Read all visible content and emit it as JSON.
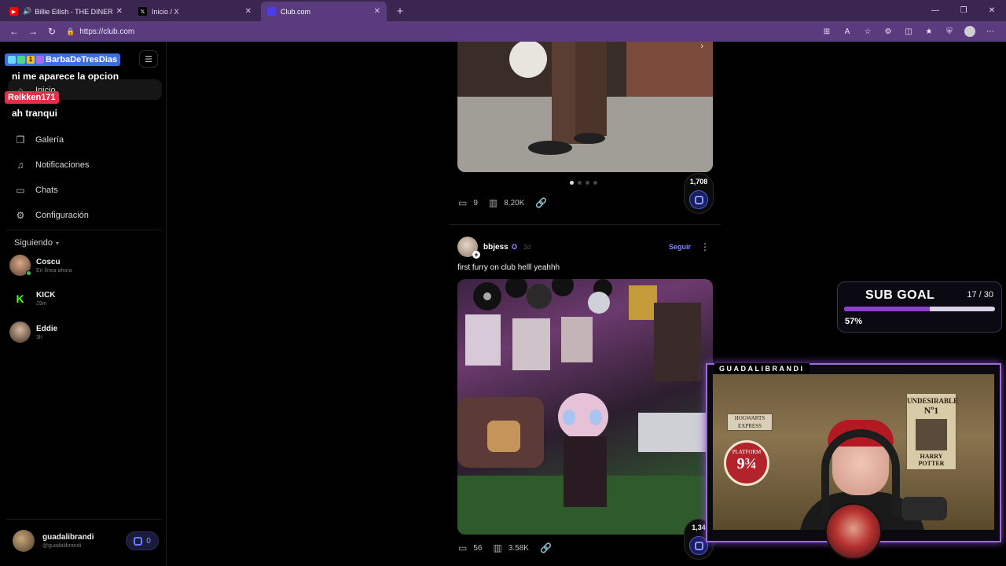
{
  "browser": {
    "tabs": [
      {
        "title": "Billie Eilish - THE DINER (Offic",
        "favicon_color": "#ff0000",
        "audio": true
      },
      {
        "title": "Inicio / X",
        "favicon_color": "#000000"
      },
      {
        "title": "Club.com",
        "favicon_color": "#4b3cf0",
        "active": true
      }
    ],
    "tab_close": "✕",
    "new_tab": "+",
    "url": "https://club.com",
    "accent": "#5a3b7e"
  },
  "chat": {
    "user1": "BarbaDeTresDias",
    "badge_count": "1",
    "msg1": "ni me aparece la opcion",
    "user2": "Reikken171",
    "msg2": "ah tranqui"
  },
  "sidebar": {
    "nav": [
      {
        "label": "Inicio",
        "icon": "home-icon"
      },
      {
        "label": "Galería",
        "icon": "gallery-icon"
      },
      {
        "label": "Notificaciones",
        "icon": "bell-icon"
      },
      {
        "label": "Chats",
        "icon": "chat-icon"
      },
      {
        "label": "Configuración",
        "icon": "gear-icon"
      }
    ],
    "following_label": "Siguiendo",
    "following": [
      {
        "name": "Coscu",
        "status": "En línea ahora"
      },
      {
        "name": "KICK",
        "status": "29m"
      },
      {
        "name": "Eddie",
        "status": "3h"
      }
    ],
    "profile": {
      "name": "guadalibrandi",
      "handle": "@guadalibrandi",
      "coins": "0"
    }
  },
  "feed": {
    "post1": {
      "comments": "9",
      "views": "8.20K",
      "score": "1,708"
    },
    "post2": {
      "author": "bbjess",
      "time": "2d",
      "follow_label": "Seguir",
      "text": "first furry on club helll yeahhh",
      "comments": "56",
      "views": "3.58K",
      "score": "1,34"
    }
  },
  "overlay": {
    "sub_goal_title": "SUB GOAL",
    "sub_goal_count": "17 / 30",
    "sub_goal_percent_text": "57%",
    "sub_goal_fraction": 0.57,
    "cam_label": "GUADALIBRANDI",
    "poster_title": "UNDESIRABLE",
    "poster_no": "Nº1",
    "poster_name": "HARRY POTTER",
    "sign_platform": "PLATFORM",
    "sign_number": "9¾",
    "sign_hogwarts": "HOGWARTS EXPRESS"
  }
}
